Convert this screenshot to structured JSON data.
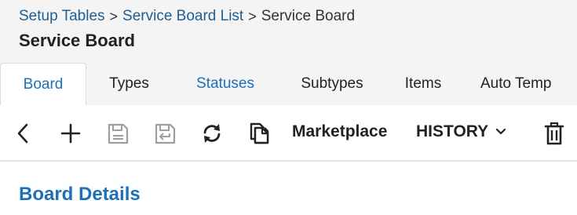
{
  "breadcrumb": {
    "items": [
      {
        "label": "Setup Tables"
      },
      {
        "label": "Service Board List"
      }
    ],
    "current": "Service Board",
    "separator": ">"
  },
  "page_title": "Service Board",
  "tabs": [
    {
      "label": "Board",
      "state": "active"
    },
    {
      "label": "Types",
      "state": "normal"
    },
    {
      "label": "Statuses",
      "state": "link"
    },
    {
      "label": "Subtypes",
      "state": "normal"
    },
    {
      "label": "Items",
      "state": "normal"
    },
    {
      "label": "Auto Temp",
      "state": "normal"
    }
  ],
  "toolbar": {
    "icons": [
      "back-icon",
      "add-icon",
      "save-icon",
      "save-and-close-icon",
      "refresh-icon",
      "copy-icon",
      "delete-icon"
    ],
    "marketplace_label": "Marketplace",
    "history_label": "HISTORY"
  },
  "section": {
    "title": "Board Details"
  },
  "colors": {
    "link": "#1c5f95",
    "active_tab": "#1c6fb8",
    "disabled_icon": "#9e9e9e",
    "header_bg": "#f4f4f4"
  }
}
